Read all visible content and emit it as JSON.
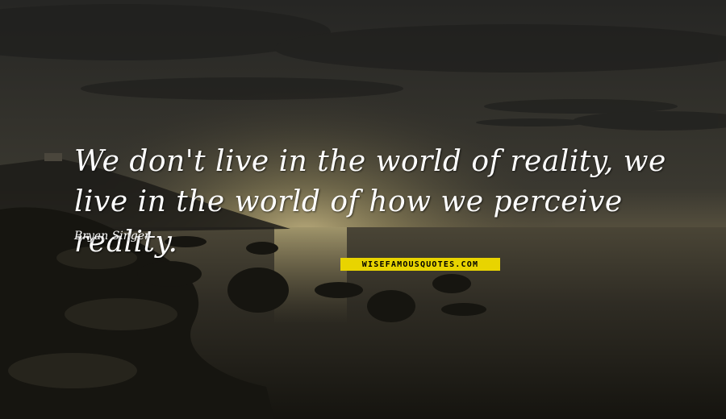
{
  "quote": {
    "text": "We don't live in the world of reality, we live in the world of how we perceive reality."
  },
  "author": {
    "name": "Bryan Singer"
  },
  "watermark": {
    "text": "WISEFAMOUSQUOTES.COM"
  },
  "colors": {
    "text": "#ffffff",
    "watermark_bg": "#e8d400",
    "sky_top": "#2a2a28",
    "sun_glow": "#a89a66",
    "sea": "#2e2b24"
  }
}
